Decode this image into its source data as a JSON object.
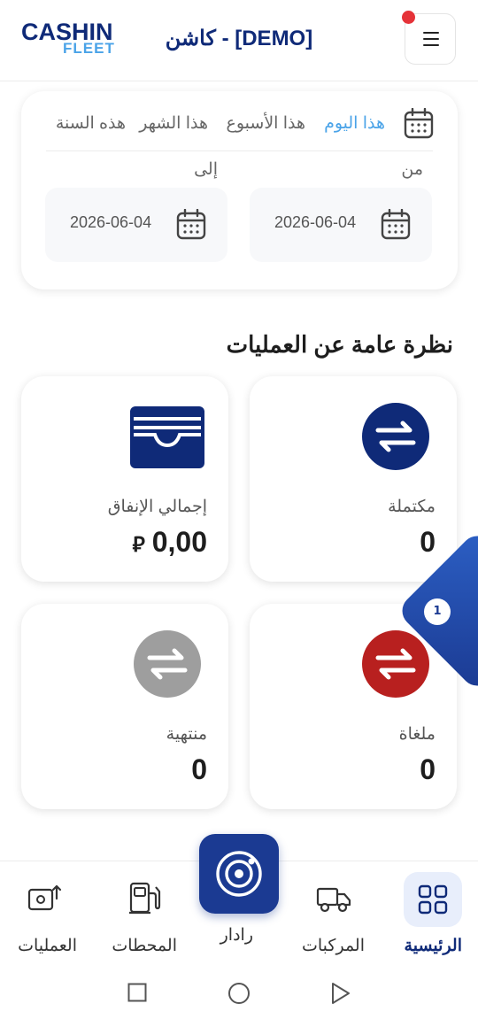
{
  "header": {
    "logo_top": "CASHIN",
    "logo_bottom": "FLEET",
    "title": "كاشن - [DEMO]",
    "menu_icon": "hamburger-icon"
  },
  "filter": {
    "tabs": [
      {
        "label": "هذا اليوم",
        "active": true
      },
      {
        "label": "هذا الأسبوع",
        "active": false
      },
      {
        "label": "هذا الشهر",
        "active": false
      },
      {
        "label": "هذه السنة",
        "active": false
      }
    ],
    "from_label": "من",
    "to_label": "إلى",
    "from_date": "2026-06-04",
    "to_date": "2026-06-04"
  },
  "overview": {
    "title": "نظرة عامة عن العمليات",
    "cards": {
      "completed": {
        "label": "مكتملة",
        "value": "0",
        "color": "#0f2a78"
      },
      "total_spend": {
        "label": "إجمالي الإنفاق",
        "value": "0,00",
        "currency": "⃁",
        "color": "#0f2a78"
      },
      "cancelled": {
        "label": "ملغاة",
        "value": "0",
        "color": "#b8201f"
      },
      "expired": {
        "label": "منتهية",
        "value": "0",
        "color": "#9e9e9e"
      }
    }
  },
  "floating_badge": {
    "count": "1"
  },
  "bottom_nav": {
    "items": [
      {
        "label": "الرئيسية",
        "active": true
      },
      {
        "label": "المركبات",
        "active": false
      },
      {
        "label": "رادار",
        "active": false
      },
      {
        "label": "المحطات",
        "active": false
      },
      {
        "label": "العمليات",
        "active": false
      }
    ]
  },
  "colors": {
    "brand_dark": "#0f2a78",
    "brand_light": "#4aa3e8",
    "notification": "#e53238"
  }
}
